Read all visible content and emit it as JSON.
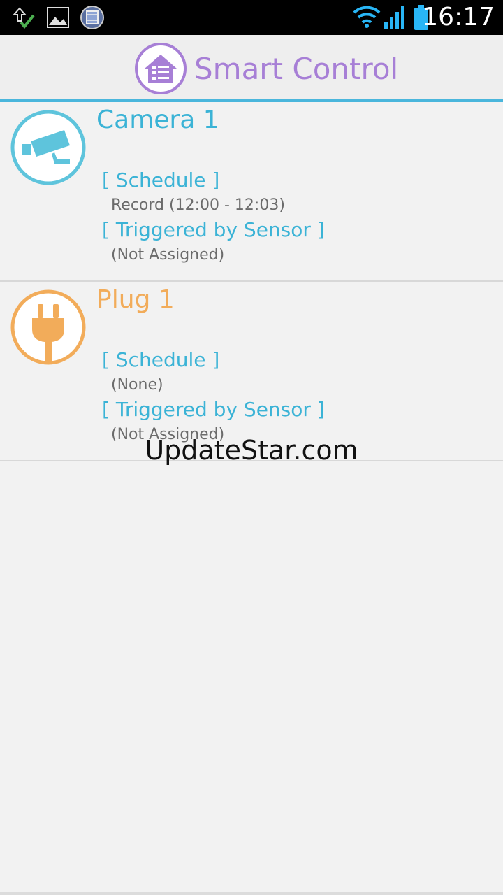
{
  "status_bar": {
    "time": "16:17",
    "icons": [
      "upload-done-icon",
      "gallery-icon",
      "film-icon",
      "wifi-icon",
      "signal-icon",
      "battery-icon"
    ],
    "accent": "#29b6f6"
  },
  "header": {
    "title": "Smart Control",
    "icon": "smart-home-icon",
    "title_color": "#a77fd6",
    "rule_color": "#4ab6dc"
  },
  "devices": [
    {
      "name": "Camera 1",
      "icon": "camera-icon",
      "color": "#5ec4dc",
      "schedule_label": "[ Schedule ]",
      "schedule_value": "Record (12:00 - 12:03)",
      "sensor_label": "[ Triggered by Sensor ]",
      "sensor_value": "(Not Assigned)"
    },
    {
      "name": "Plug 1",
      "icon": "plug-icon",
      "color": "#f2ac5a",
      "schedule_label": "[ Schedule ]",
      "schedule_value": "(None)",
      "sensor_label": "[ Triggered by Sensor ]",
      "sensor_value": "(Not Assigned)"
    }
  ],
  "watermark": "UpdateStar.com"
}
